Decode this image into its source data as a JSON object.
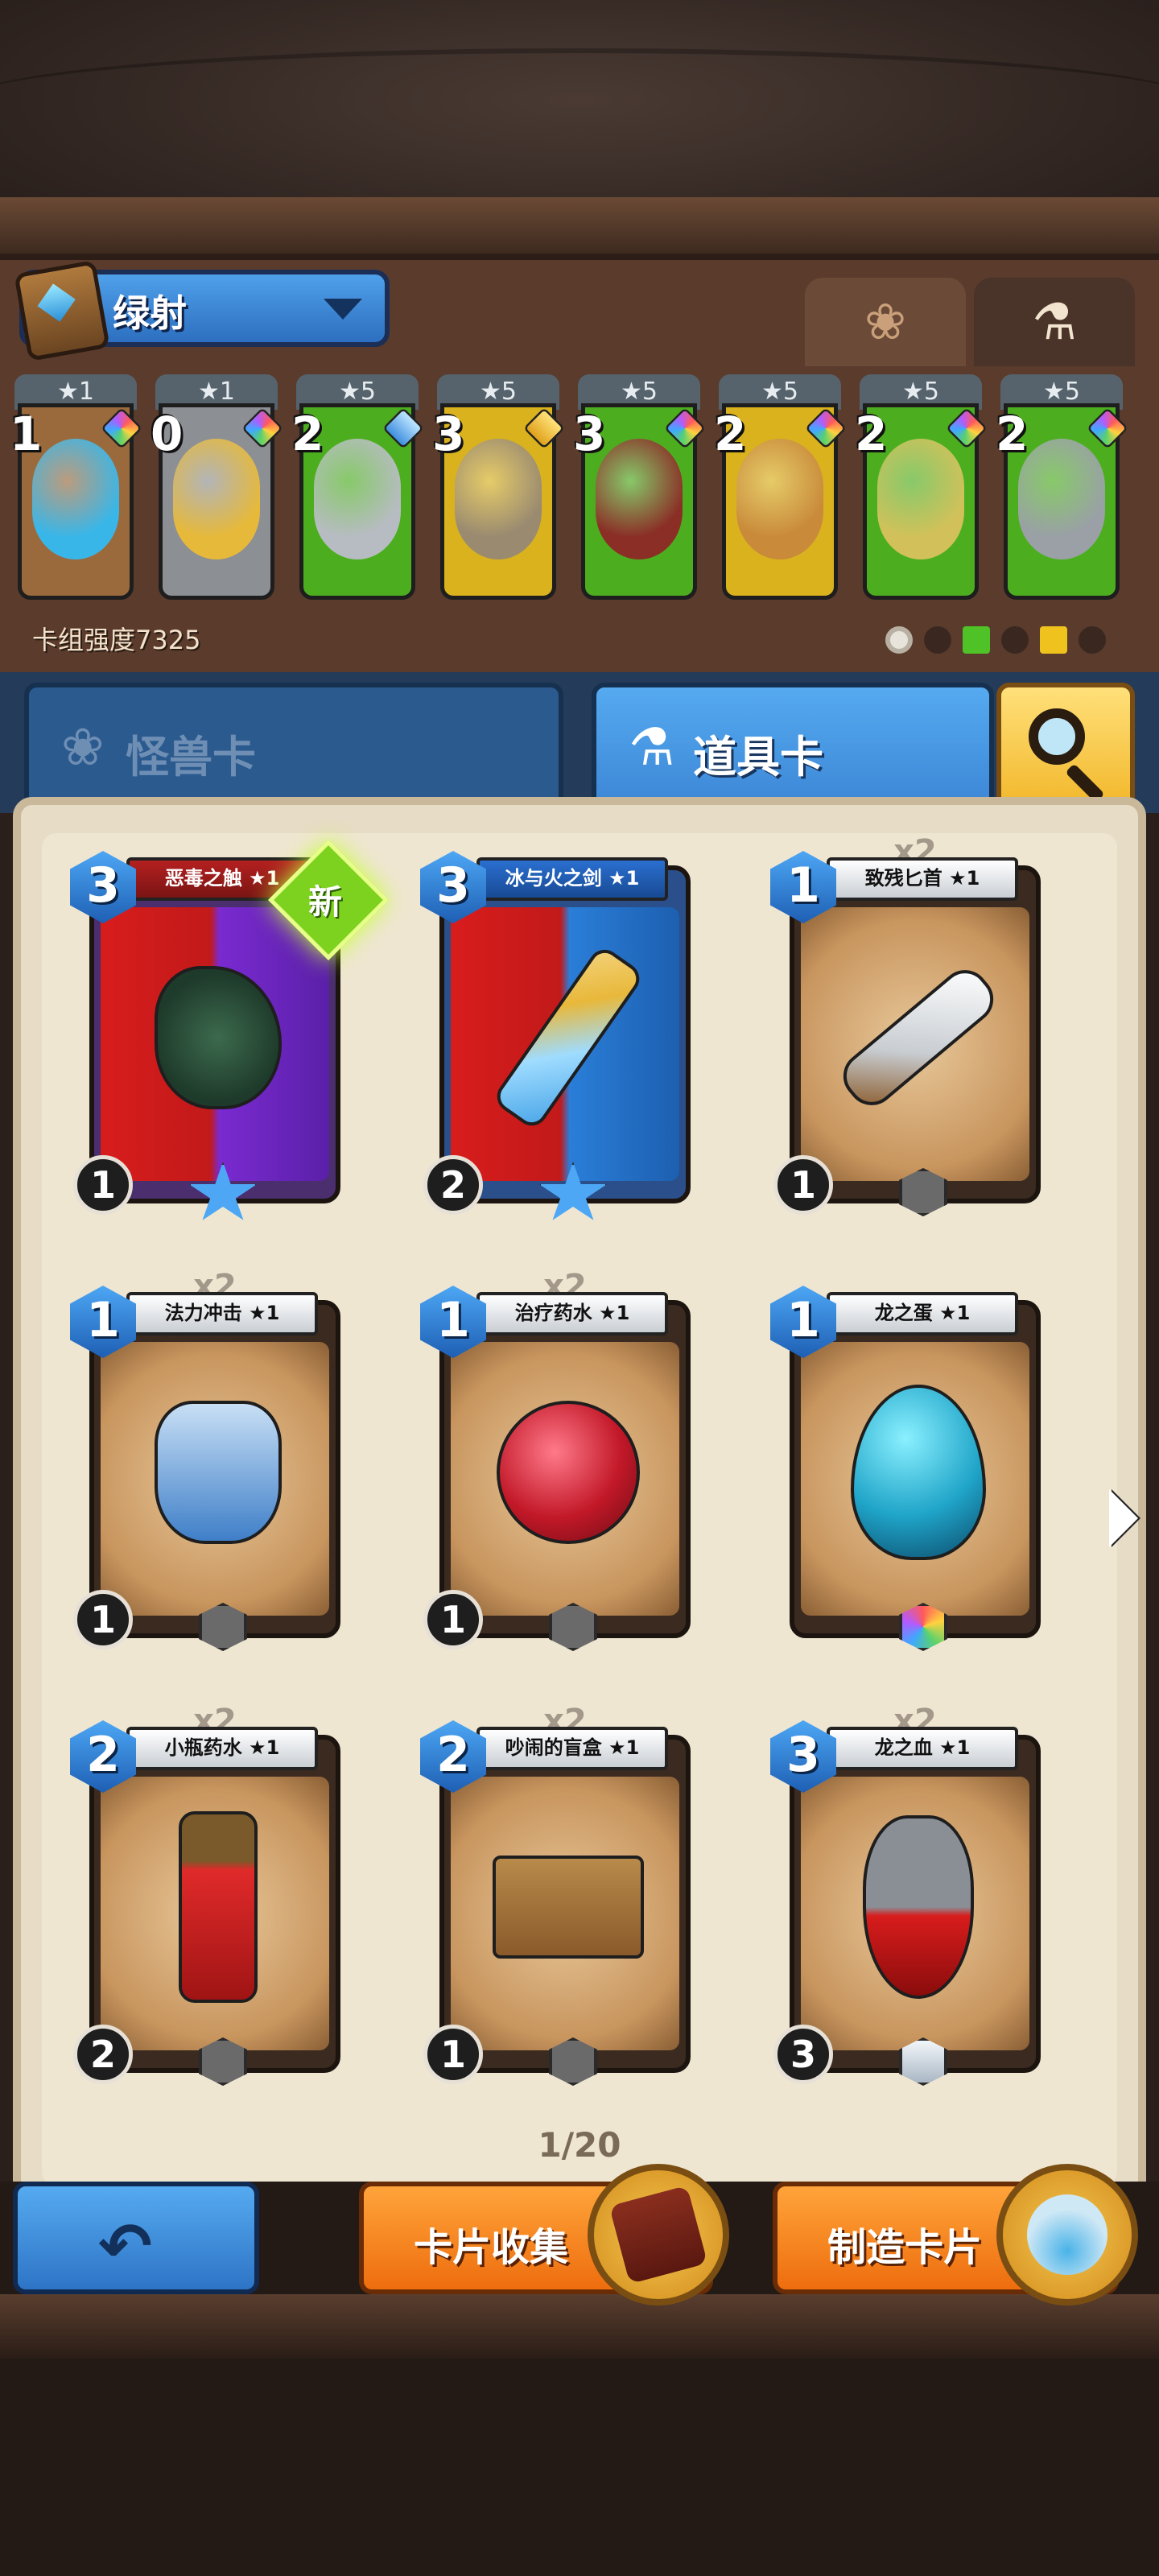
{
  "deck": {
    "name": "绿射",
    "power_label": "卡组强度7325",
    "tabs": [
      {
        "icon": "paw-icon"
      },
      {
        "icon": "potion-icon"
      }
    ],
    "cards": [
      {
        "rank": "★1",
        "cost": "1",
        "gem": "rainbow",
        "color": "#9a6a3c",
        "pic": "#39b6e8"
      },
      {
        "rank": "★1",
        "cost": "0",
        "gem": "rainbow",
        "color": "#8c8f94",
        "pic": "#e6b93a"
      },
      {
        "rank": "★5",
        "cost": "2",
        "gem": "blue",
        "color": "#4cae1f",
        "pic": "#b7bcc2"
      },
      {
        "rank": "★5",
        "cost": "3",
        "gem": "gold",
        "color": "#d9b21d",
        "pic": "#9a8a70"
      },
      {
        "rank": "★5",
        "cost": "3",
        "gem": "rainbow",
        "color": "#4cae1f",
        "pic": "#8a2e26"
      },
      {
        "rank": "★5",
        "cost": "2",
        "gem": "rainbow",
        "color": "#d9b21d",
        "pic": "#c98a3a"
      },
      {
        "rank": "★5",
        "cost": "2",
        "gem": "rainbow",
        "color": "#4cae1f",
        "pic": "#d2c15a"
      },
      {
        "rank": "★5",
        "cost": "2",
        "gem": "rainbow",
        "color": "#4cae1f",
        "pic": "#9aa0a6"
      }
    ]
  },
  "categories": {
    "monster": "怪兽卡",
    "item": "道具卡"
  },
  "cards": [
    {
      "name": "恶毒之触 ★1",
      "cost": "3",
      "stat": "1",
      "count": "",
      "type": "legend",
      "new": "新",
      "rarity": "star"
    },
    {
      "name": "冰与火之剑 ★1",
      "cost": "3",
      "stat": "2",
      "count": "",
      "type": "epic",
      "new": "",
      "rarity": "star"
    },
    {
      "name": "致残匕首 ★1",
      "cost": "1",
      "stat": "1",
      "count": "x2",
      "type": "common",
      "new": "",
      "rarity": "plain"
    },
    {
      "name": "法力冲击 ★1",
      "cost": "1",
      "stat": "1",
      "count": "x2",
      "type": "common",
      "new": "",
      "rarity": "plain"
    },
    {
      "name": "治疗药水 ★1",
      "cost": "1",
      "stat": "1",
      "count": "x2",
      "type": "common",
      "new": "",
      "rarity": "plain"
    },
    {
      "name": "龙之蛋 ★1",
      "cost": "1",
      "stat": "",
      "count": "",
      "type": "common",
      "new": "",
      "rarity": "rainbow"
    },
    {
      "name": "小瓶药水 ★1",
      "cost": "2",
      "stat": "2",
      "count": "x2",
      "type": "common",
      "new": "",
      "rarity": "plain"
    },
    {
      "name": "吵闹的盲盒 ★1",
      "cost": "2",
      "stat": "1",
      "count": "x2",
      "type": "common",
      "new": "",
      "rarity": "plain"
    },
    {
      "name": "龙之血 ★1",
      "cost": "3",
      "stat": "3",
      "count": "x2",
      "type": "common",
      "new": "",
      "rarity": "silver"
    }
  ],
  "pager": "1/20",
  "buttons": {
    "collect": "卡片收集",
    "craft": "制造卡片"
  }
}
